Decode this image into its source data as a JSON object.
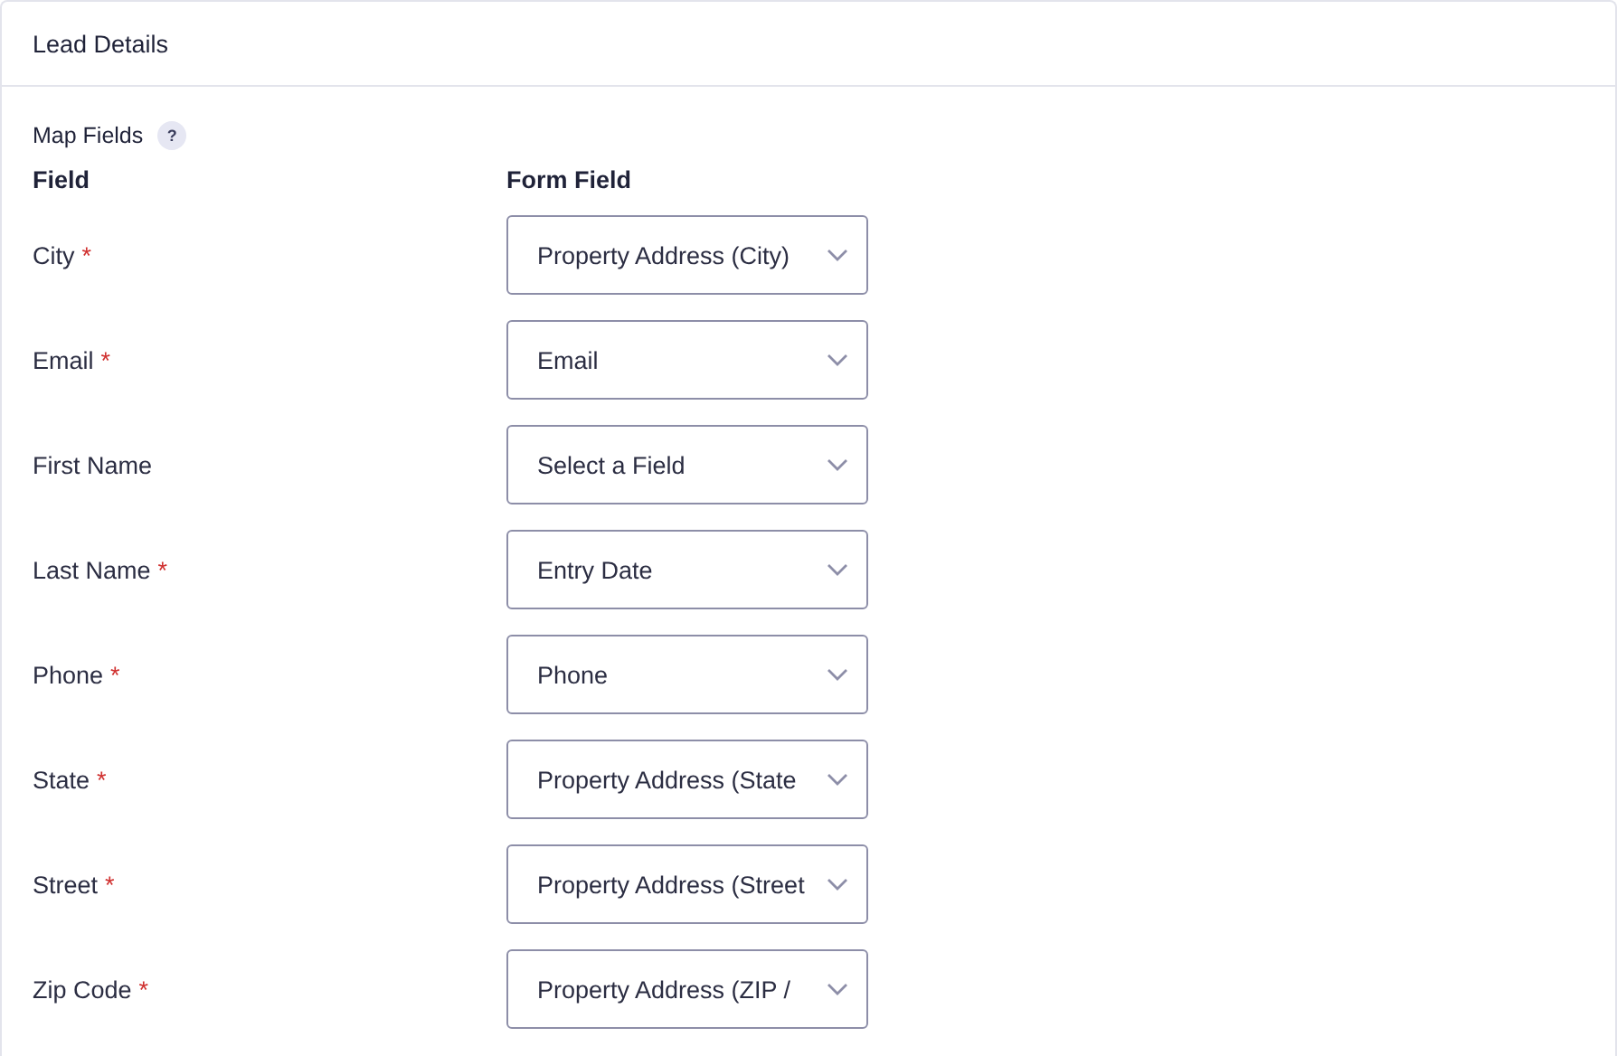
{
  "panel": {
    "title": "Lead Details"
  },
  "map_fields": {
    "label": "Map Fields",
    "help": "?"
  },
  "columns": [
    "Field",
    "Form Field"
  ],
  "rows": [
    {
      "field": "City",
      "required": true,
      "value": "Property Address (City)"
    },
    {
      "field": "Email",
      "required": true,
      "value": "Email"
    },
    {
      "field": "First Name",
      "required": false,
      "value": "Select a Field"
    },
    {
      "field": "Last Name",
      "required": true,
      "value": "Entry Date"
    },
    {
      "field": "Phone",
      "required": true,
      "value": "Phone"
    },
    {
      "field": "State",
      "required": true,
      "value": "Property Address (State"
    },
    {
      "field": "Street",
      "required": true,
      "value": "Property Address (Street"
    },
    {
      "field": "Zip Code",
      "required": true,
      "value": "Property Address (ZIP /"
    }
  ],
  "required_mark": "*"
}
